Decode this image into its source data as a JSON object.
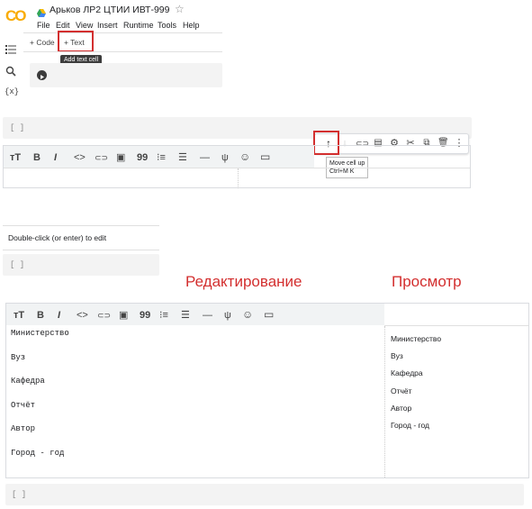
{
  "header": {
    "logo_text": "CO",
    "drive_icon": "drive-icon",
    "notebook_title": "Арьков ЛР2 ЦТИИ ИВТ-999",
    "star_icon": "star-icon",
    "menu": [
      "File",
      "Edit",
      "View",
      "Insert",
      "Runtime",
      "Tools",
      "Help"
    ]
  },
  "sidebar": {
    "icons": [
      "list-icon",
      "search-icon",
      "variables-icon"
    ],
    "variables_label": "{x}"
  },
  "cell_toolbar": {
    "add_code_label": "+ Code",
    "add_text_label": "+ Text",
    "add_text_tooltip": "Add text cell"
  },
  "run_button_icon": "play-icon",
  "empty_cell_bracket": "[ ]",
  "cell_actions": {
    "icons": [
      "arrow-up-icon",
      "arrow-down-icon",
      "link-icon",
      "comment-icon",
      "gear-icon",
      "scissors-icon",
      "copy-icon",
      "trash-icon",
      "more-vert-icon"
    ],
    "tooltip_line1": "Move cell up",
    "tooltip_line2": "Ctrl+M K"
  },
  "text_format_toolbar": {
    "tools": [
      "тT",
      "B",
      "I",
      "<>",
      "⊂⊃",
      "▣",
      "99",
      "⁝≡",
      "☰",
      "—",
      "ψ",
      "☺",
      "▭"
    ]
  },
  "placeholder_cell": {
    "text": "Double-click (or enter) to edit"
  },
  "annotations": {
    "edit_label": "Редактирование",
    "preview_label": "Просмотр"
  },
  "editor": {
    "lines": [
      "Министерство",
      "Вуз",
      "Кафедра",
      "Отчёт",
      "Автор",
      "Город - год"
    ]
  },
  "preview": {
    "lines": [
      "Министерство",
      "Вуз",
      "Кафедра",
      "Отчёт",
      "Автор",
      "Город - год"
    ]
  },
  "colors": {
    "colab_orange": "#f9ab00",
    "annotation_red": "#d32f2f"
  }
}
